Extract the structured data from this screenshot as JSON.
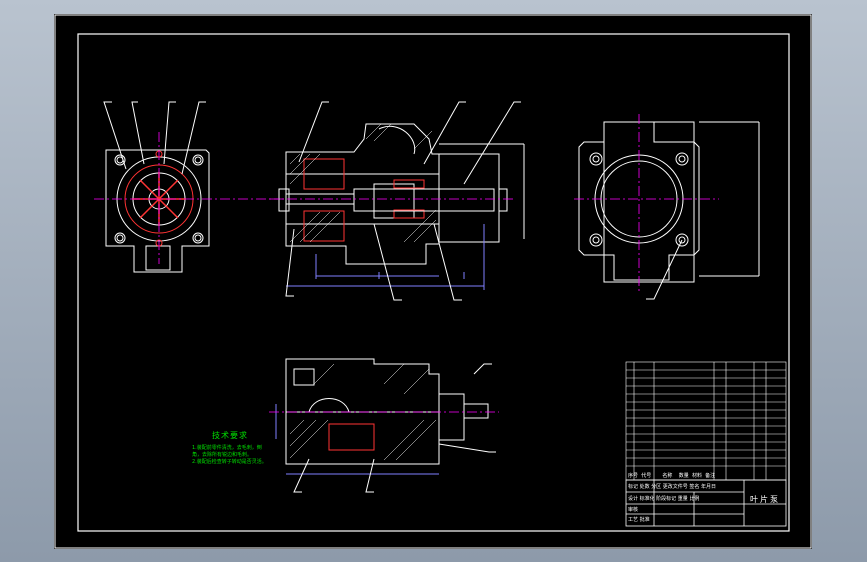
{
  "drawing": {
    "title_block_name": "叶片泵",
    "tech_requirements": {
      "title": "技术要求",
      "notes": [
        "1.装配前零件清洗，去毛刺，倒",
        "角，去除所有锐边和毛刺。",
        "2.装配后检查转子转动是否灵活。"
      ]
    },
    "title_block_rows": [
      "标记 处数 分区 更改文件号 签名 年月日",
      "设计        标准化        阶段标记 重量 比例",
      "审核",
      "工艺        批准"
    ],
    "parts_list_header": [
      "序号",
      "代号",
      "名称",
      "数量",
      "材料",
      "备注"
    ],
    "colors": {
      "outline": "#ffffff",
      "centerline": "#ff00ff",
      "dimension": "#8080ff",
      "hidden": "#ff3333",
      "notes": "#00e000",
      "leader": "#ffffff"
    }
  }
}
